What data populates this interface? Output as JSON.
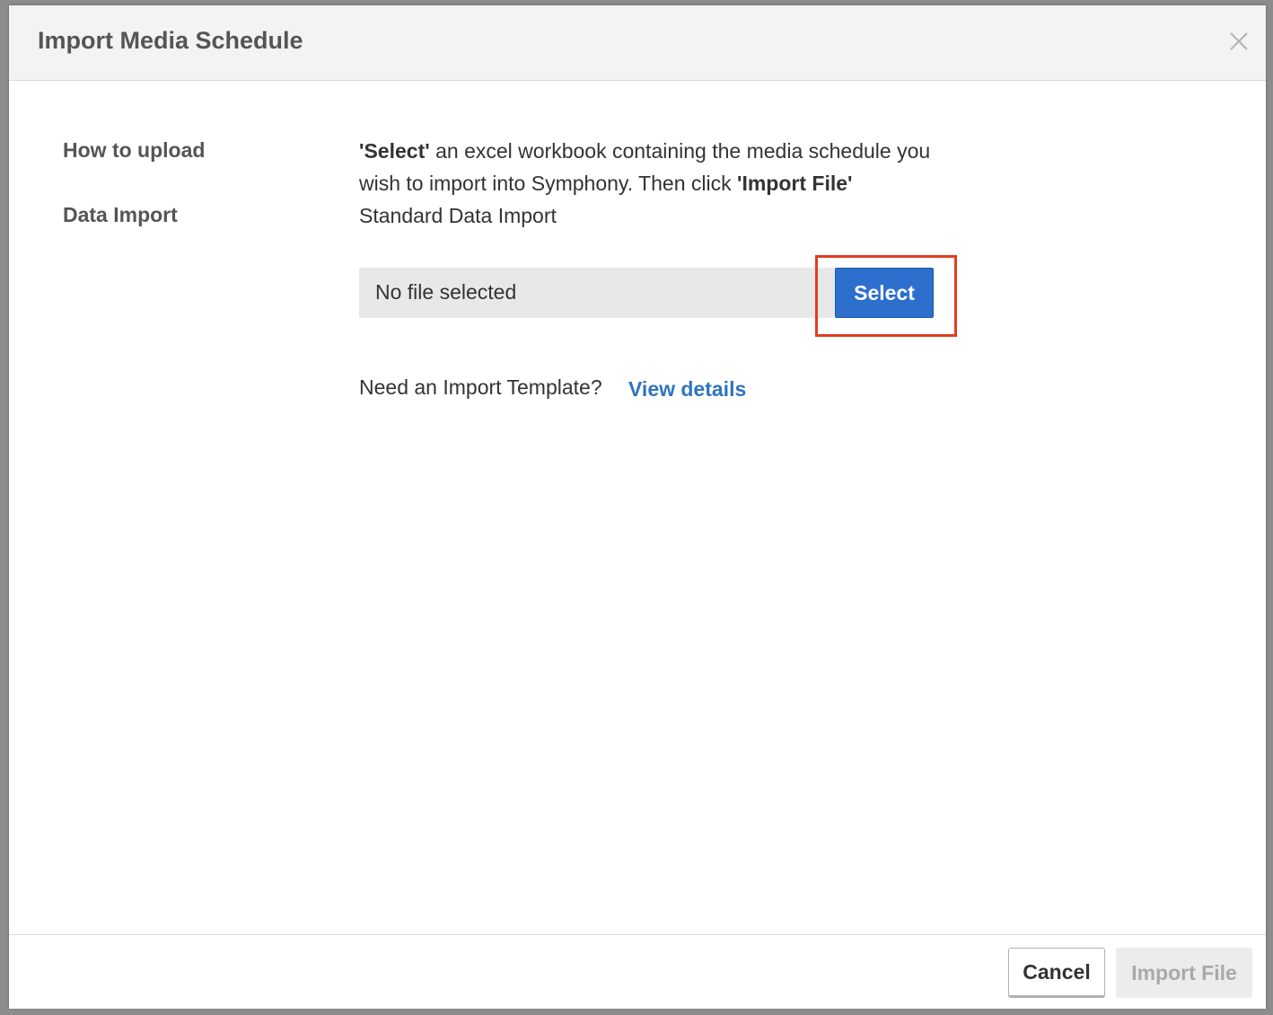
{
  "dialog": {
    "title": "Import Media Schedule"
  },
  "how_to_upload": {
    "label": "How to upload",
    "text_part1_bold": "'Select'",
    "text_part2": " an excel workbook containing the media schedule you wish to import into Symphony. Then click ",
    "text_part3_bold": "'Import File'"
  },
  "data_import": {
    "label": "Data Import",
    "value": "Standard Data Import"
  },
  "file_picker": {
    "status": "No file selected",
    "select_label": "Select"
  },
  "template": {
    "question": "Need an Import Template?",
    "link_label": "View details"
  },
  "footer": {
    "cancel_label": "Cancel",
    "import_label": "Import File"
  },
  "colors": {
    "primary": "#2c6fcd",
    "link": "#2f74bf",
    "highlight": "#e23e1f"
  }
}
